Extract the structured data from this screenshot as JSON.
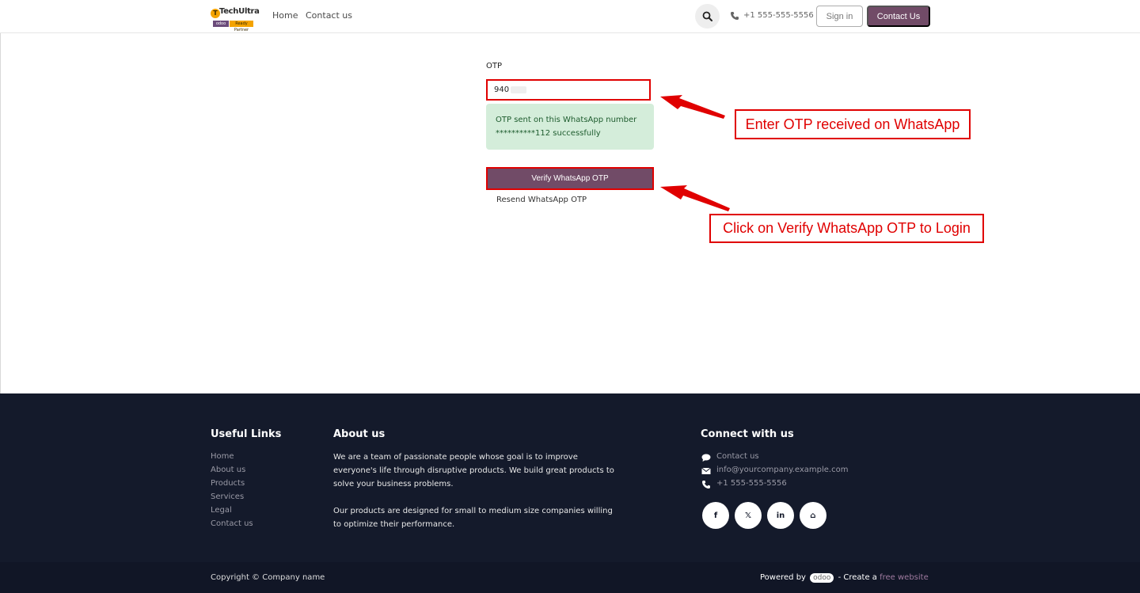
{
  "header": {
    "logo_text": "TechUltra",
    "logo_tag_left": "odoo",
    "logo_tag_right": "Ready Partner",
    "nav": [
      "Home",
      "Contact us"
    ],
    "phone": "+1 555-555-5556",
    "signin_label": "Sign in",
    "contact_label": "Contact Us",
    "icons": {
      "search": "search-icon",
      "phone": "phone-icon"
    }
  },
  "form": {
    "otp_label": "OTP",
    "otp_value": "940",
    "alert_line1": "OTP sent on this WhatsApp number",
    "alert_line2": "**********112 successfully",
    "verify_label": "Verify WhatsApp OTP",
    "resend_label": "Resend WhatsApp OTP"
  },
  "annotations": {
    "callout1": "Enter OTP received on WhatsApp",
    "callout2": "Click on Verify WhatsApp OTP to Login",
    "color": "#e00000"
  },
  "footer": {
    "useful_links_title": "Useful Links",
    "useful_links": [
      "Home",
      "About us",
      "Products",
      "Services",
      "Legal",
      "Contact us"
    ],
    "about_title": "About us",
    "about_p1_l1": "We are a team of passionate people whose goal is to improve",
    "about_p1_l2": "everyone's life through disruptive products. We build great products to",
    "about_p1_l3": "solve your business problems.",
    "about_p2_l1": "Our products are designed for small to medium size companies willing",
    "about_p2_l2": "to optimize their performance.",
    "connect_title": "Connect with us",
    "connect_items": [
      "Contact us",
      "info@yourcompany.example.com",
      "+1 555-555-5556"
    ],
    "social": [
      "f",
      "𝕏",
      "in",
      "⌂"
    ],
    "social_icons": [
      "facebook-icon",
      "x-icon",
      "linkedin-icon",
      "home-icon"
    ],
    "copyright": "Copyright © Company name",
    "powered_by": "Powered by",
    "odoo_badge": "odoo",
    "create_text": "- Create a",
    "free_website": "free website"
  },
  "colors": {
    "primary": "#714b67",
    "footer_bg": "#141a2b",
    "alert_bg": "#d4edda"
  }
}
